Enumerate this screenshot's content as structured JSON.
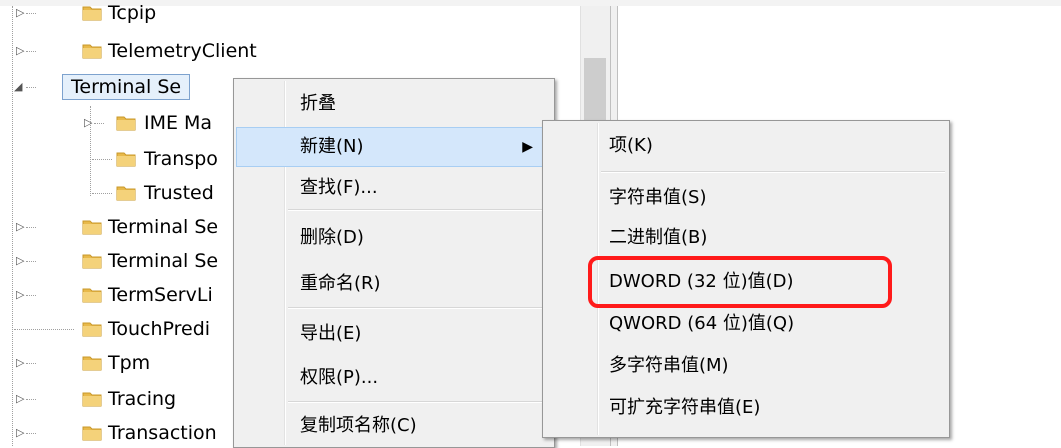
{
  "tree": {
    "items": [
      {
        "label": "Tcpip",
        "expander": "▷"
      },
      {
        "label": "TelemetryClient",
        "expander": "▷"
      },
      {
        "label": "Terminal Se",
        "expander": "◢"
      },
      {
        "label": "IME Ma",
        "expander": "▷"
      },
      {
        "label": "Transpo",
        "expander": ""
      },
      {
        "label": "Trusted",
        "expander": ""
      },
      {
        "label": "Terminal Se",
        "expander": "▷"
      },
      {
        "label": "Terminal Se",
        "expander": "▷"
      },
      {
        "label": "TermServLi",
        "expander": "▷"
      },
      {
        "label": "TouchPredi",
        "expander": ""
      },
      {
        "label": "Tpm",
        "expander": "▷"
      },
      {
        "label": "Tracing",
        "expander": "▷"
      },
      {
        "label": "Transaction",
        "expander": "▷"
      }
    ]
  },
  "context_menu": {
    "items": [
      {
        "label": "折叠"
      },
      {
        "label": "新建(N)",
        "submenu_arrow": "▶"
      },
      {
        "label": "查找(F)..."
      },
      {
        "label": "删除(D)"
      },
      {
        "label": "重命名(R)"
      },
      {
        "label": "导出(E)"
      },
      {
        "label": "权限(P)..."
      },
      {
        "label": "复制项名称(C)"
      }
    ]
  },
  "submenu": {
    "items": [
      {
        "label": "项(K)"
      },
      {
        "label": "字符串值(S)"
      },
      {
        "label": "二进制值(B)"
      },
      {
        "label": "DWORD (32 位)值(D)"
      },
      {
        "label": "QWORD (64 位)值(Q)"
      },
      {
        "label": "多字符串值(M)"
      },
      {
        "label": "可扩充字符串值(E)"
      }
    ]
  },
  "colors": {
    "highlight": "#d4e7fb",
    "annotation_red": "#ff1a1a",
    "folder": "#e8b94a"
  }
}
